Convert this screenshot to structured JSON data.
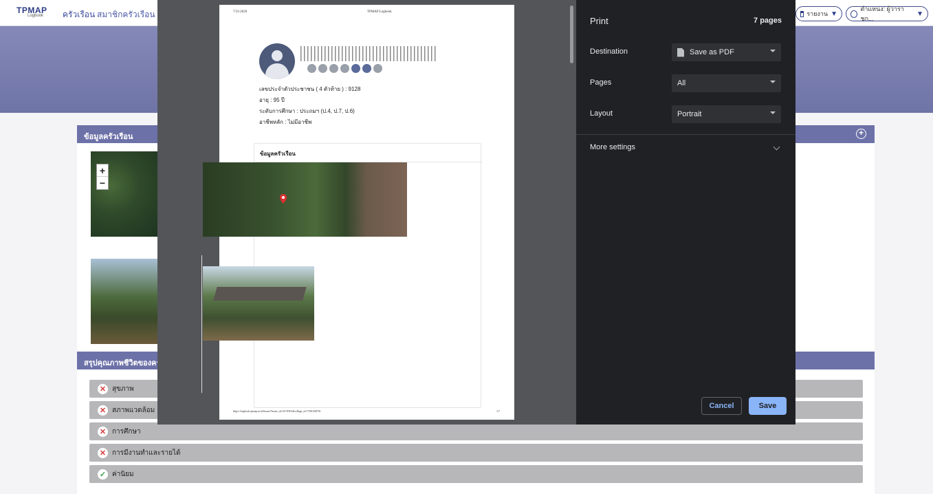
{
  "app": {
    "logo_text": "TPMAP",
    "logo_sub": "Logbook",
    "nav_links": [
      "ครัวเรือน",
      "สมาชิกครัวเรือน"
    ],
    "report_label": "รายงาน",
    "position_label": "ตำแหน่ง: ผู้ว่าราชก...",
    "section_household": "ข้อมูลครัวเรือน",
    "section_summary": "สรุปคุณภาพชีวิตของครัวเรื",
    "map_zoom_in": "+",
    "map_zoom_out": "−",
    "summary_items": [
      {
        "label": "สุขภาพ",
        "status": "bad"
      },
      {
        "label": "สภาพแวดล้อม",
        "status": "bad"
      },
      {
        "label": "การศึกษา",
        "status": "bad"
      },
      {
        "label": "การมีงานทำและรายได้",
        "status": "bad"
      },
      {
        "label": "ค่านิยม",
        "status": "good"
      }
    ],
    "colors": {
      "brand": "#2d3c86",
      "banner": "#6f74a6",
      "section": "#6c71a8"
    }
  },
  "preview": {
    "date": "7/31/2020",
    "doc_title": "TPMAP Logbook",
    "citizen_id": "เลขประจำตัวประชาชน ( 4 ตัวท้าย )  :  9128",
    "age": "อายุ  :  95  ปี",
    "education": "ระดับการศึกษา  :  ประถมฯ (ป.4, ป.7, ป.6)",
    "occupation": "อาชีพหลัก  :  ไม่มีอาชีพ",
    "card_title": "ข้อมูลครัวเรือน",
    "footer_url": "https://logbook.tpmap.in.th/house?house_id=2574501&village_id=7501040701",
    "footer_page": "1/7"
  },
  "print": {
    "title": "Print",
    "page_count": "7 pages",
    "destination_label": "Destination",
    "destination_value": "Save as PDF",
    "pages_label": "Pages",
    "pages_value": "All",
    "layout_label": "Layout",
    "layout_value": "Portrait",
    "more_settings": "More settings",
    "cancel_label": "Cancel",
    "save_label": "Save",
    "colors": {
      "panel": "#202124",
      "accent": "#8ab4f8"
    }
  }
}
